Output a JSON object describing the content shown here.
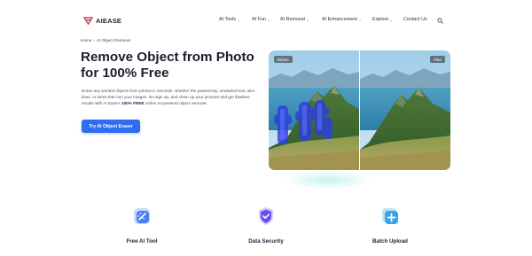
{
  "brand": {
    "name": "AIEASE"
  },
  "nav": {
    "items": [
      {
        "label": "AI Tools",
        "has_dropdown": true
      },
      {
        "label": "AI Fun",
        "has_dropdown": true
      },
      {
        "label": "AI Removal",
        "has_dropdown": true
      },
      {
        "label": "AI Enhancement",
        "has_dropdown": true
      },
      {
        "label": "Explore",
        "has_dropdown": true
      },
      {
        "label": "Contact Us",
        "has_dropdown": false
      }
    ],
    "caret": "⌄",
    "search_icon": "search-icon"
  },
  "breadcrumb": {
    "home": "Home",
    "separator": "»",
    "current": "AI Object Remover"
  },
  "hero": {
    "title": "Remove Object from Photo for 100% Free",
    "description_pre": "Erase any wanted objects from photos in seconds, whether the passers-by, unwanted text, wire lines, or items that ruin your images. No sign up, and clean up your pictures and get flawless results with AI Ease's ",
    "description_bold": "100% FREE",
    "description_post": " online AI-powered object remover.",
    "cta_label": "Try AI Object Eraser"
  },
  "compare": {
    "before_label": "Before",
    "after_label": "After"
  },
  "features": [
    {
      "label": "Free AI Tool",
      "icon": "magic-wand-icon"
    },
    {
      "label": "Data Security",
      "icon": "shield-check-icon"
    },
    {
      "label": "Batch Upload",
      "icon": "plus-layers-icon"
    }
  ],
  "colors": {
    "accent": "#2f6cf0",
    "logo_red": "#e8473f",
    "logo_blue": "#3a5bd9",
    "brush_blue": "#2b3fe0"
  }
}
